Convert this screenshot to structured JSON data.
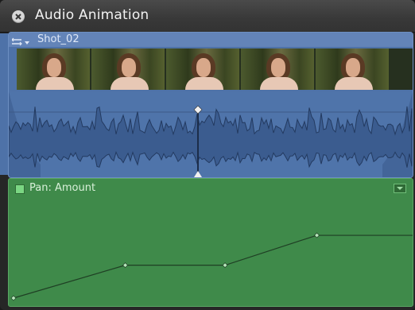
{
  "window": {
    "title": "Audio Animation"
  },
  "clip": {
    "name": "Shot_02",
    "frame_count": 5
  },
  "automation": {
    "parameter_label": "Pan: Amount",
    "keyframes": [
      {
        "t": 0.0,
        "value": 0.0
      },
      {
        "t": 0.28,
        "value": 0.44
      },
      {
        "t": 0.53,
        "value": 0.44
      },
      {
        "t": 0.76,
        "value": 0.84
      },
      {
        "t": 1.0,
        "value": 0.84
      }
    ]
  },
  "colors": {
    "clip_blue": "#4e72a8",
    "automation_green": "#3f8a4a",
    "keyframe_line": "#1f3f24"
  }
}
